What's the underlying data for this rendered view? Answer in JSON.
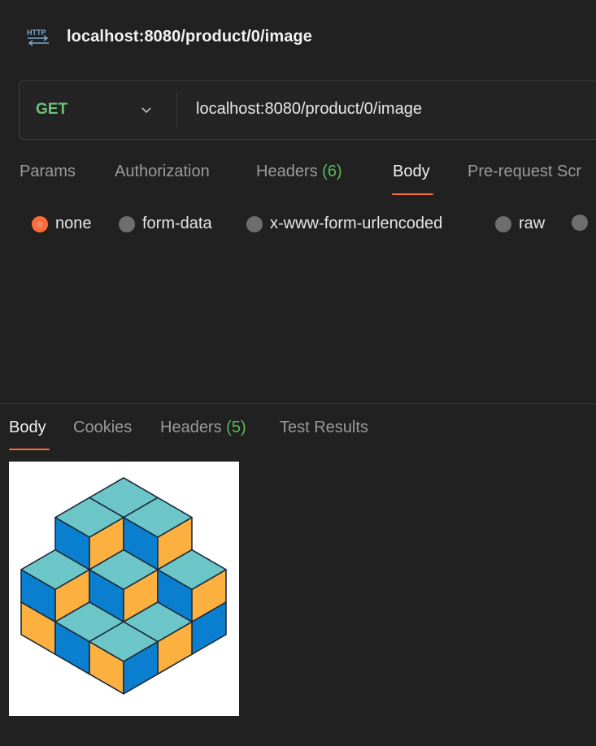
{
  "request": {
    "title": "localhost:8080/product/0/image",
    "icon": "http-icon",
    "method": "GET",
    "url": "localhost:8080/product/0/image"
  },
  "request_tabs": [
    {
      "label": "Params",
      "count": ""
    },
    {
      "label": "Authorization",
      "count": ""
    },
    {
      "label": "Headers ",
      "count": "(6)"
    },
    {
      "label": "Body",
      "count": "",
      "active": true
    },
    {
      "label": "Pre-request Scr",
      "count": ""
    }
  ],
  "body_types": [
    {
      "label": "none",
      "selected": true
    },
    {
      "label": "form-data",
      "selected": false
    },
    {
      "label": "x-www-form-urlencoded",
      "selected": false
    },
    {
      "label": "raw",
      "selected": false
    },
    {
      "label": "",
      "selected": false
    }
  ],
  "response_tabs": [
    {
      "label": "Body",
      "count": "",
      "active": true
    },
    {
      "label": "Cookies",
      "count": ""
    },
    {
      "label": "Headers ",
      "count": "(5)"
    },
    {
      "label": "Test Results",
      "count": ""
    }
  ],
  "colors": {
    "accent": "#ff6c37",
    "method_get": "#6ec27b",
    "count_green": "#5cb85c",
    "cube_cyan": "#6cc6c8",
    "cube_blue": "#0a7fd0",
    "cube_orange": "#fbb040"
  }
}
